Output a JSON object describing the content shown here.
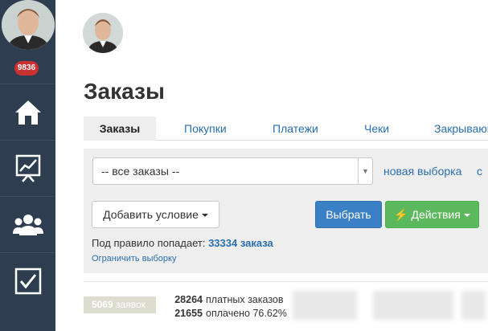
{
  "sidebar": {
    "badge": "9836",
    "items": [
      {
        "icon": "home-icon"
      },
      {
        "icon": "chart-icon"
      },
      {
        "icon": "users-icon"
      },
      {
        "icon": "checkbox-icon"
      }
    ]
  },
  "page": {
    "title": "Заказы"
  },
  "tabs": [
    {
      "label": "Заказы",
      "active": true
    },
    {
      "label": "Покупки"
    },
    {
      "label": "Платежи"
    },
    {
      "label": "Чеки"
    },
    {
      "label": "Закрывающие"
    }
  ],
  "filter": {
    "select_value": "-- все заказы --",
    "new_selection": "новая выборка",
    "add_condition": "Добавить условие",
    "choose": "Выбрать",
    "actions": "Действия",
    "rule_prefix": "Под правило попадает:",
    "rule_count": "33334 заказа",
    "limit_link": "Ограничить выборку"
  },
  "summary": {
    "count_num": "5069",
    "count_label": "заявок",
    "paid_orders_num": "28264",
    "paid_orders_label": "платных заказов",
    "paid_num": "21655",
    "paid_label": "оплачено 76.62%"
  },
  "colors": {
    "sidebar": "#2e3d4f",
    "badge": "#c8312f",
    "primary": "#3b7fc4",
    "success": "#5cb85c",
    "link": "#2a6fb0"
  }
}
